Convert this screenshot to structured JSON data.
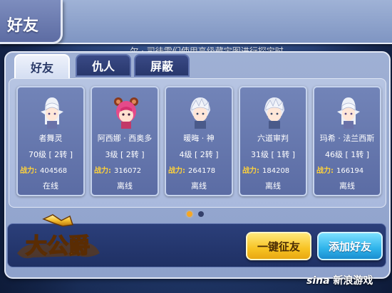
{
  "title": "好友",
  "broadcast": "尔 · 司徒雷们使用高级藏宝图进行探宝时",
  "tabs": [
    {
      "label": "好友",
      "active": true
    },
    {
      "label": "仇人",
      "active": false
    },
    {
      "label": "屏蔽",
      "active": false
    }
  ],
  "power_label": "战力:",
  "friends": [
    {
      "name": "者舞灵",
      "level": "70级 [ 2转 ]",
      "power": "404568",
      "status": "在线",
      "avatar": "white-hair-elf"
    },
    {
      "name": "阿西娜 · 西奥多",
      "level": "3级 [ 2转 ]",
      "power": "316072",
      "status": "离线",
      "avatar": "pink-hair-girl"
    },
    {
      "name": "暖晦 · 神",
      "level": "4级 [ 2转 ]",
      "power": "264178",
      "status": "离线",
      "avatar": "white-hair-boy"
    },
    {
      "name": "六道审判",
      "level": "31级 [ 1转 ]",
      "power": "184208",
      "status": "离线",
      "avatar": "white-hair-boy"
    },
    {
      "name": "玛希 · 法兰西斯",
      "level": "46级 [ 1转 ]",
      "power": "166194",
      "status": "离线",
      "avatar": "white-hair-elf"
    }
  ],
  "pager": {
    "current": 1,
    "total": 2
  },
  "buttons": {
    "recruit": "一键征友",
    "add": "添加好友"
  },
  "logo_text": "大公爵",
  "watermark": {
    "brand": "sina",
    "text": "新浪游戏"
  },
  "colors": {
    "power_label": "#ffd23a",
    "recruit_button": "#f7c323",
    "add_button": "#2fb3ea"
  }
}
